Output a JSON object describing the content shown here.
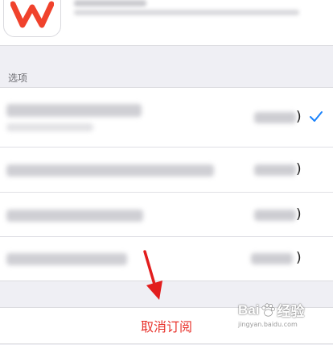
{
  "section": {
    "title": "选项"
  },
  "options": [
    {
      "selected": true
    },
    {
      "selected": false
    },
    {
      "selected": false
    },
    {
      "selected": false
    }
  ],
  "cancel": {
    "label": "取消订阅"
  },
  "watermark": {
    "brand": "Bai",
    "brand_suffix": "经验",
    "url": "jingyan.baidu.com"
  },
  "colors": {
    "accent": "#1a82fb",
    "destructive": "#e8312a",
    "annotation_arrow": "#e21d1d",
    "app_logo": "#f0422c"
  },
  "icons": {
    "app": "wps-office-logo-icon",
    "selected_mark": "checkmark-icon",
    "annotation": "red-arrow-down-icon"
  }
}
